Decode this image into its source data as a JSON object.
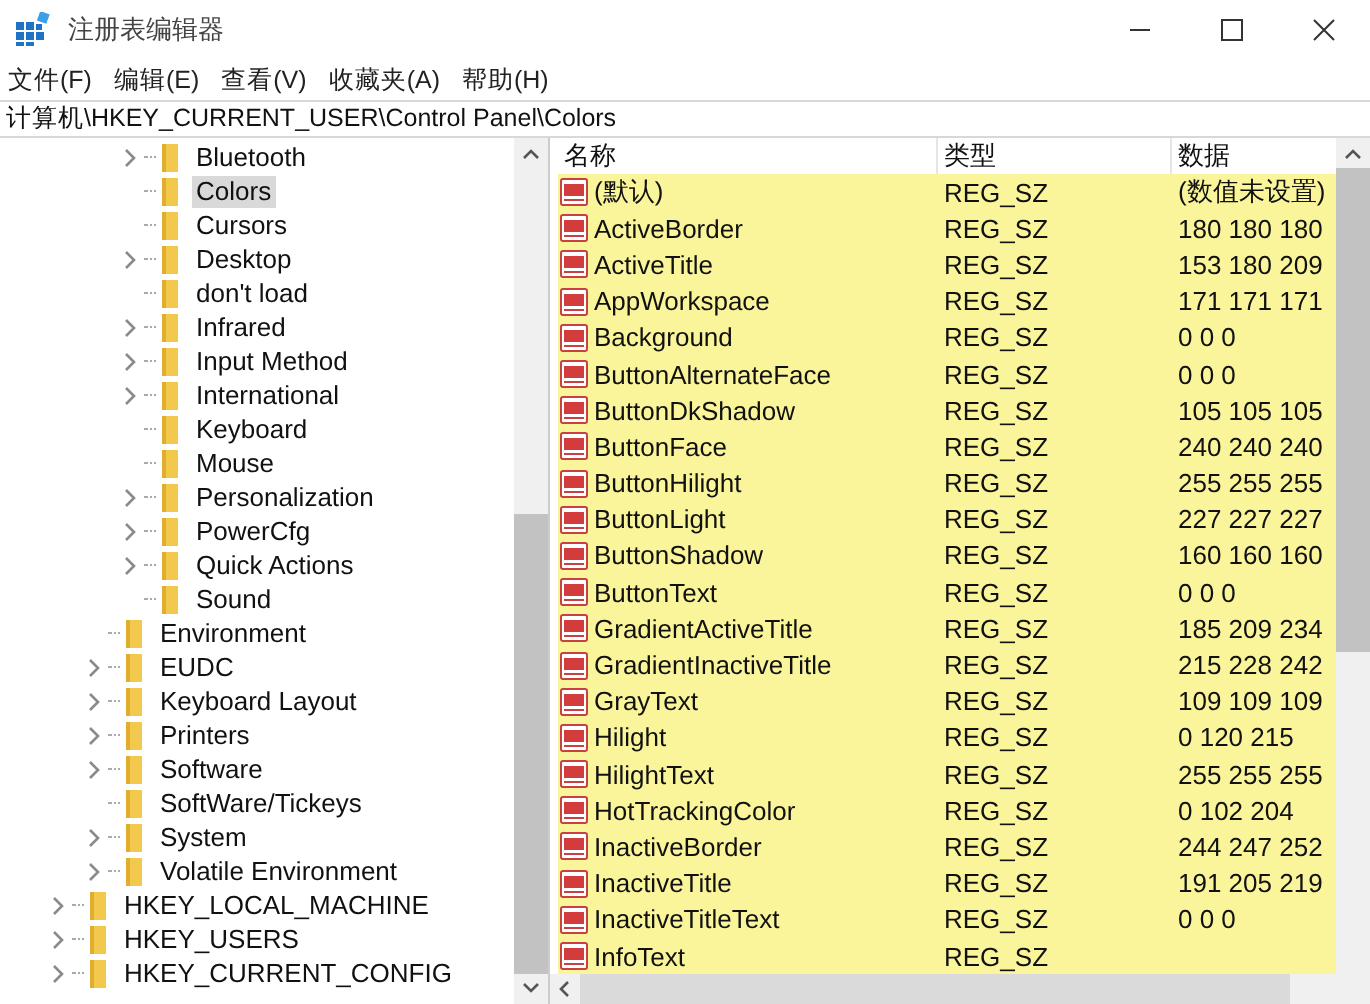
{
  "window": {
    "title": "注册表编辑器"
  },
  "menu": [
    "文件(F)",
    "编辑(E)",
    "查看(V)",
    "收藏夹(A)",
    "帮助(H)"
  ],
  "address": "计算机\\HKEY_CURRENT_USER\\Control Panel\\Colors",
  "tree": [
    {
      "children": [
        {
          "children": [
            {
              "label": "Bluetooth",
              "expandable": true,
              "selected": false
            },
            {
              "label": "Colors",
              "expandable": false,
              "selected": true
            },
            {
              "label": "Cursors",
              "expandable": false,
              "selected": false
            },
            {
              "label": "Desktop",
              "expandable": true,
              "selected": false
            },
            {
              "label": "don't load",
              "expandable": false,
              "selected": false
            },
            {
              "label": "Infrared",
              "expandable": true,
              "selected": false
            },
            {
              "label": "Input Method",
              "expandable": true,
              "selected": false
            },
            {
              "label": "International",
              "expandable": true,
              "selected": false
            },
            {
              "label": "Keyboard",
              "expandable": false,
              "selected": false
            },
            {
              "label": "Mouse",
              "expandable": false,
              "selected": false
            },
            {
              "label": "Personalization",
              "expandable": true,
              "selected": false
            },
            {
              "label": "PowerCfg",
              "expandable": true,
              "selected": false
            },
            {
              "label": "Quick Actions",
              "expandable": true,
              "selected": false
            },
            {
              "label": "Sound",
              "expandable": false,
              "selected": false
            }
          ]
        },
        {
          "label": "Environment",
          "expandable": false,
          "selected": false
        },
        {
          "label": "EUDC",
          "expandable": true,
          "selected": false
        },
        {
          "label": "Keyboard Layout",
          "expandable": true,
          "selected": false
        },
        {
          "label": "Printers",
          "expandable": true,
          "selected": false
        },
        {
          "label": "Software",
          "expandable": true,
          "selected": false
        },
        {
          "label": "SoftWare/Tickeys",
          "expandable": false,
          "selected": false
        },
        {
          "label": "System",
          "expandable": true,
          "selected": false
        },
        {
          "label": "Volatile Environment",
          "expandable": true,
          "selected": false
        }
      ]
    },
    {
      "label": "HKEY_LOCAL_MACHINE",
      "expandable": true,
      "selected": false
    },
    {
      "label": "HKEY_USERS",
      "expandable": true,
      "selected": false
    },
    {
      "label": "HKEY_CURRENT_CONFIG",
      "expandable": true,
      "selected": false
    }
  ],
  "table": {
    "columns": [
      "名称",
      "类型",
      "数据"
    ],
    "rows": [
      {
        "name": "(默认)",
        "type": "REG_SZ",
        "data": "(数值未设置)"
      },
      {
        "name": "ActiveBorder",
        "type": "REG_SZ",
        "data": "180 180 180"
      },
      {
        "name": "ActiveTitle",
        "type": "REG_SZ",
        "data": "153 180 209"
      },
      {
        "name": "AppWorkspace",
        "type": "REG_SZ",
        "data": "171 171 171"
      },
      {
        "name": "Background",
        "type": "REG_SZ",
        "data": "0 0 0"
      },
      {
        "name": "ButtonAlternateFace",
        "type": "REG_SZ",
        "data": "0 0 0"
      },
      {
        "name": "ButtonDkShadow",
        "type": "REG_SZ",
        "data": "105 105 105"
      },
      {
        "name": "ButtonFace",
        "type": "REG_SZ",
        "data": "240 240 240"
      },
      {
        "name": "ButtonHilight",
        "type": "REG_SZ",
        "data": "255 255 255"
      },
      {
        "name": "ButtonLight",
        "type": "REG_SZ",
        "data": "227 227 227"
      },
      {
        "name": "ButtonShadow",
        "type": "REG_SZ",
        "data": "160 160 160"
      },
      {
        "name": "ButtonText",
        "type": "REG_SZ",
        "data": "0 0 0"
      },
      {
        "name": "GradientActiveTitle",
        "type": "REG_SZ",
        "data": "185 209 234"
      },
      {
        "name": "GradientInactiveTitle",
        "type": "REG_SZ",
        "data": "215 228 242"
      },
      {
        "name": "GrayText",
        "type": "REG_SZ",
        "data": "109 109 109"
      },
      {
        "name": "Hilight",
        "type": "REG_SZ",
        "data": "0 120 215"
      },
      {
        "name": "HilightText",
        "type": "REG_SZ",
        "data": "255 255 255"
      },
      {
        "name": "HotTrackingColor",
        "type": "REG_SZ",
        "data": "0 102 204"
      },
      {
        "name": "InactiveBorder",
        "type": "REG_SZ",
        "data": "244 247 252"
      },
      {
        "name": "InactiveTitle",
        "type": "REG_SZ",
        "data": "191 205 219"
      },
      {
        "name": "InactiveTitleText",
        "type": "REG_SZ",
        "data": "0 0 0"
      },
      {
        "name": "InfoText",
        "type": "REG_SZ"
      }
    ]
  }
}
